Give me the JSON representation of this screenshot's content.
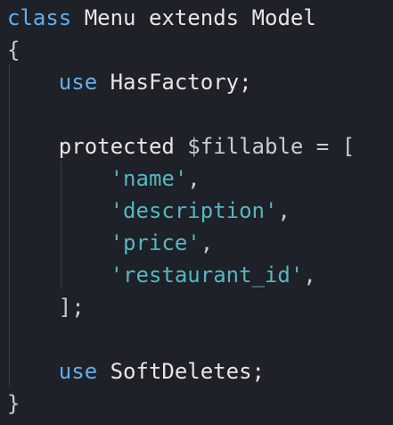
{
  "editor": {
    "lines": [
      {
        "tokens": [
          {
            "text": "class",
            "kind": "kw-blue"
          },
          {
            "text": " Menu ",
            "kind": "kw-plain"
          },
          {
            "text": "extends",
            "kind": "kw-plain"
          },
          {
            "text": " Model",
            "kind": "kw-plain"
          }
        ]
      },
      {
        "tokens": [
          {
            "text": "{",
            "kind": "punc"
          }
        ]
      },
      {
        "tokens": [
          {
            "text": "    ",
            "kind": "punc"
          },
          {
            "text": "use",
            "kind": "kw-blue"
          },
          {
            "text": " HasFactory;",
            "kind": "kw-plain"
          }
        ]
      },
      {
        "tokens": [
          {
            "text": "",
            "kind": "punc"
          }
        ]
      },
      {
        "tokens": [
          {
            "text": "    protected ",
            "kind": "kw-plain"
          },
          {
            "text": "$fillable",
            "kind": "var"
          },
          {
            "text": " = [",
            "kind": "punc"
          }
        ]
      },
      {
        "tokens": [
          {
            "text": "        ",
            "kind": "punc"
          },
          {
            "text": "'name'",
            "kind": "str"
          },
          {
            "text": ",",
            "kind": "punc"
          }
        ]
      },
      {
        "tokens": [
          {
            "text": "        ",
            "kind": "punc"
          },
          {
            "text": "'description'",
            "kind": "str"
          },
          {
            "text": ",",
            "kind": "punc"
          }
        ]
      },
      {
        "tokens": [
          {
            "text": "        ",
            "kind": "punc"
          },
          {
            "text": "'price'",
            "kind": "str"
          },
          {
            "text": ",",
            "kind": "punc"
          }
        ]
      },
      {
        "tokens": [
          {
            "text": "        ",
            "kind": "punc"
          },
          {
            "text": "'restaurant_id'",
            "kind": "str"
          },
          {
            "text": ",",
            "kind": "punc"
          }
        ]
      },
      {
        "tokens": [
          {
            "text": "    ];",
            "kind": "punc"
          }
        ]
      },
      {
        "tokens": [
          {
            "text": "",
            "kind": "punc"
          }
        ]
      },
      {
        "tokens": [
          {
            "text": "    ",
            "kind": "punc"
          },
          {
            "text": "use",
            "kind": "kw-blue"
          },
          {
            "text": " SoftDeletes;",
            "kind": "kw-plain"
          }
        ]
      },
      {
        "tokens": [
          {
            "text": "}",
            "kind": "punc"
          }
        ]
      }
    ]
  },
  "colors": {
    "background": "#1e2127",
    "keyword": "#61afef",
    "string": "#56b6c2",
    "text": "#e6e6e6"
  }
}
